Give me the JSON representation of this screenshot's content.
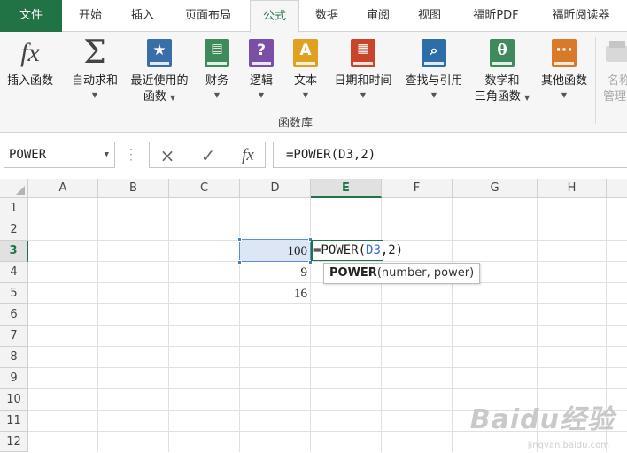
{
  "tabs": [
    {
      "label": "文件",
      "kind": "file"
    },
    {
      "label": "开始"
    },
    {
      "label": "插入"
    },
    {
      "label": "页面布局"
    },
    {
      "label": "公式",
      "active": true
    },
    {
      "label": "数据"
    },
    {
      "label": "审阅"
    },
    {
      "label": "视图"
    },
    {
      "label": "福昕PDF"
    },
    {
      "label": "福昕阅读器"
    }
  ],
  "ribbon": {
    "buttons": [
      {
        "label": "插入函数",
        "icon": "fx-icon"
      },
      {
        "label": "自动求和",
        "icon": "sigma-icon"
      },
      {
        "label": "最近使用的",
        "label2": "函数",
        "icon": "star-book-icon",
        "color": "#3a6ea8"
      },
      {
        "label": "财务",
        "icon": "coins-book-icon",
        "color": "#3f8a5a"
      },
      {
        "label": "逻辑",
        "icon": "question-book-icon",
        "color": "#7b4fa6"
      },
      {
        "label": "文本",
        "icon": "letter-a-book-icon",
        "color": "#e0a020"
      },
      {
        "label": "日期和时间",
        "icon": "calendar-book-icon",
        "color": "#c8442a"
      },
      {
        "label": "查找与引用",
        "icon": "magnifier-book-icon",
        "color": "#2f6da8"
      },
      {
        "label": "数学和",
        "label2": "三角函数",
        "icon": "theta-book-icon",
        "color": "#3f8a5a"
      },
      {
        "label": "其他函数",
        "icon": "dots-book-icon",
        "color": "#d97a2a"
      },
      {
        "label": "名称",
        "label2": "管理",
        "icon": "name-manager-icon"
      }
    ],
    "group_label": "函数库"
  },
  "formula_bar": {
    "name_box": "POWER",
    "cancel_icon": "×",
    "enter_icon": "✓",
    "fx_icon": "fx",
    "formula": "=POWER(D3,2)"
  },
  "sheet": {
    "columns": [
      "A",
      "B",
      "C",
      "D",
      "E",
      "F",
      "G",
      "H"
    ],
    "rows": [
      "1",
      "2",
      "3",
      "4",
      "5",
      "6",
      "7",
      "8",
      "9",
      "10",
      "11",
      "12"
    ],
    "selected_column": "E",
    "selected_row": "3",
    "cells": {
      "D3": "100",
      "D4": "9",
      "D5": "16"
    },
    "edit": {
      "prefix": "=POWER(",
      "ref": "D3",
      "suffix": ",2)"
    },
    "tooltip": {
      "func": "POWER",
      "args": "(number, power)"
    }
  },
  "watermark": {
    "text": "Baidu经验",
    "sub": "jingyan.baidu.com"
  }
}
